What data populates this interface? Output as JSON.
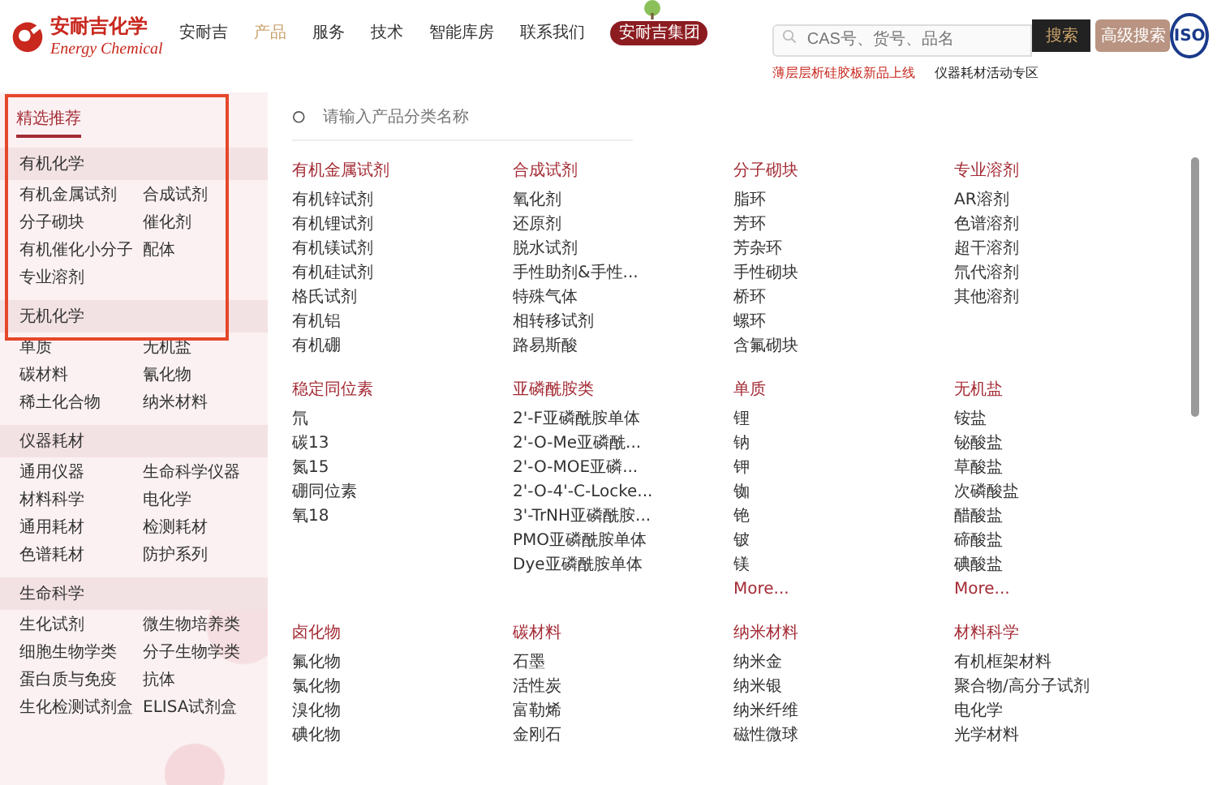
{
  "header": {
    "logo": {
      "name": "安耐吉化学",
      "subtitle": "Energy Chemical"
    },
    "nav": [
      {
        "label": "安耐吉",
        "selected": false
      },
      {
        "label": "产品",
        "selected": true
      },
      {
        "label": "服务",
        "selected": false
      },
      {
        "label": "技术",
        "selected": false
      },
      {
        "label": "智能库房",
        "selected": false
      },
      {
        "label": "联系我们",
        "selected": false
      }
    ],
    "group_badge": "安耐吉集团",
    "search": {
      "placeholder": "CAS号、货号、品名"
    },
    "search_button": "搜索",
    "advanced_button": "高级搜索",
    "promo_links": [
      {
        "text": "薄层层析硅胶板新品上线",
        "kind": "highlight"
      },
      {
        "text": "仪器耗材活动专区",
        "kind": "normal"
      }
    ],
    "iso_logo": "ISO"
  },
  "sidebar": {
    "title": "精选推荐",
    "groups": [
      {
        "title": "有机化学",
        "items": [
          "有机金属试剂",
          "合成试剂",
          "分子砌块",
          "催化剂",
          "有机催化小分子",
          "配体",
          "专业溶剂"
        ]
      },
      {
        "title": "无机化学",
        "items": [
          "单质",
          "无机盐",
          "碳材料",
          "氰化物",
          "稀土化合物",
          "纳米材料"
        ]
      },
      {
        "title": "仪器耗材",
        "items": [
          "通用仪器",
          "生命科学仪器",
          "材料科学",
          "电化学",
          "通用耗材",
          "检测耗材",
          "色谱耗材",
          "防护系列"
        ]
      },
      {
        "title": "生命科学",
        "items": [
          "生化试剂",
          "微生物培养类",
          "细胞生物学类",
          "分子生物学类",
          "蛋白质与免疫",
          "抗体",
          "生化检测试剂盒",
          "ELISA试剂盒"
        ]
      }
    ]
  },
  "main": {
    "search": {
      "placeholder": "请输入产品分类名称"
    },
    "categories": [
      {
        "title": "有机金属试剂",
        "items": [
          "有机锌试剂",
          "有机锂试剂",
          "有机镁试剂",
          "有机硅试剂",
          "格氏试剂",
          "有机铝",
          "有机硼"
        ]
      },
      {
        "title": "合成试剂",
        "items": [
          "氧化剂",
          "还原剂",
          "脱水试剂",
          "手性助剂&手性...",
          "特殊气体",
          "相转移试剂",
          "路易斯酸"
        ]
      },
      {
        "title": "分子砌块",
        "items": [
          "脂环",
          "芳环",
          "芳杂环",
          "手性砌块",
          "桥环",
          "螺环",
          "含氟砌块"
        ]
      },
      {
        "title": "专业溶剂",
        "items": [
          "AR溶剂",
          "色谱溶剂",
          "超干溶剂",
          "氘代溶剂",
          "其他溶剂"
        ]
      },
      {
        "title": "稳定同位素",
        "items": [
          "氘",
          "碳13",
          "氮15",
          "硼同位素",
          "氧18"
        ]
      },
      {
        "title": "亚磷酰胺类",
        "items": [
          "2'-F亚磷酰胺单体",
          "2'-O-Me亚磷酰...",
          "2'-O-MOE亚磷...",
          "2'-O-4'-C-Locke...",
          "3'-TrNH亚磷酰胺...",
          "PMO亚磷酰胺单体",
          "Dye亚磷酰胺单体"
        ]
      },
      {
        "title": "单质",
        "items": [
          "锂",
          "钠",
          "钾",
          "铷",
          "铯",
          "铍",
          "镁"
        ],
        "more": "More..."
      },
      {
        "title": "无机盐",
        "items": [
          "铵盐",
          "铋酸盐",
          "草酸盐",
          "次磷酸盐",
          "醋酸盐",
          "碲酸盐",
          "碘酸盐"
        ],
        "more": "More..."
      },
      {
        "title": "卤化物",
        "items": [
          "氟化物",
          "氯化物",
          "溴化物",
          "碘化物"
        ]
      },
      {
        "title": "碳材料",
        "items": [
          "石墨",
          "活性炭",
          "富勒烯",
          "金刚石"
        ]
      },
      {
        "title": "纳米材料",
        "items": [
          "纳米金",
          "纳米银",
          "纳米纤维",
          "磁性微球"
        ]
      },
      {
        "title": "材料科学",
        "items": [
          "有机框架材料",
          "聚合物/高分子试剂",
          "电化学",
          "光学材料"
        ]
      }
    ]
  }
}
